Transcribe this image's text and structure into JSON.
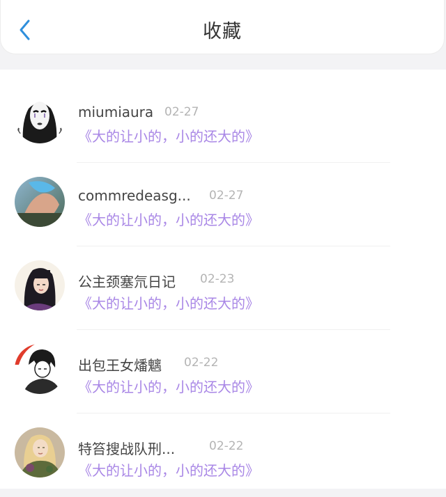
{
  "header": {
    "title": "收藏",
    "back_icon": "chevron-left-icon",
    "accent": "#2f8fdc"
  },
  "colors": {
    "book_title": "#a987e6",
    "date": "#b4b4b4"
  },
  "favorites": [
    {
      "user": "miumiaura",
      "date": "02-27",
      "book": "《大的让小的，小的还大的》"
    },
    {
      "user": "commredeasg...",
      "date": "02-27",
      "book": "《大的让小的，小的还大的》"
    },
    {
      "user": "公主颈塞氘日记",
      "date": "02-23",
      "book": "《大的让小的，小的还大的》"
    },
    {
      "user": "出包王女燔魑",
      "date": "02-22",
      "book": "《大的让小的，小的还大的》"
    },
    {
      "user": "特笞搜战队刑...",
      "date": "02-22",
      "book": "《大的让小的，小的还大的》"
    }
  ]
}
